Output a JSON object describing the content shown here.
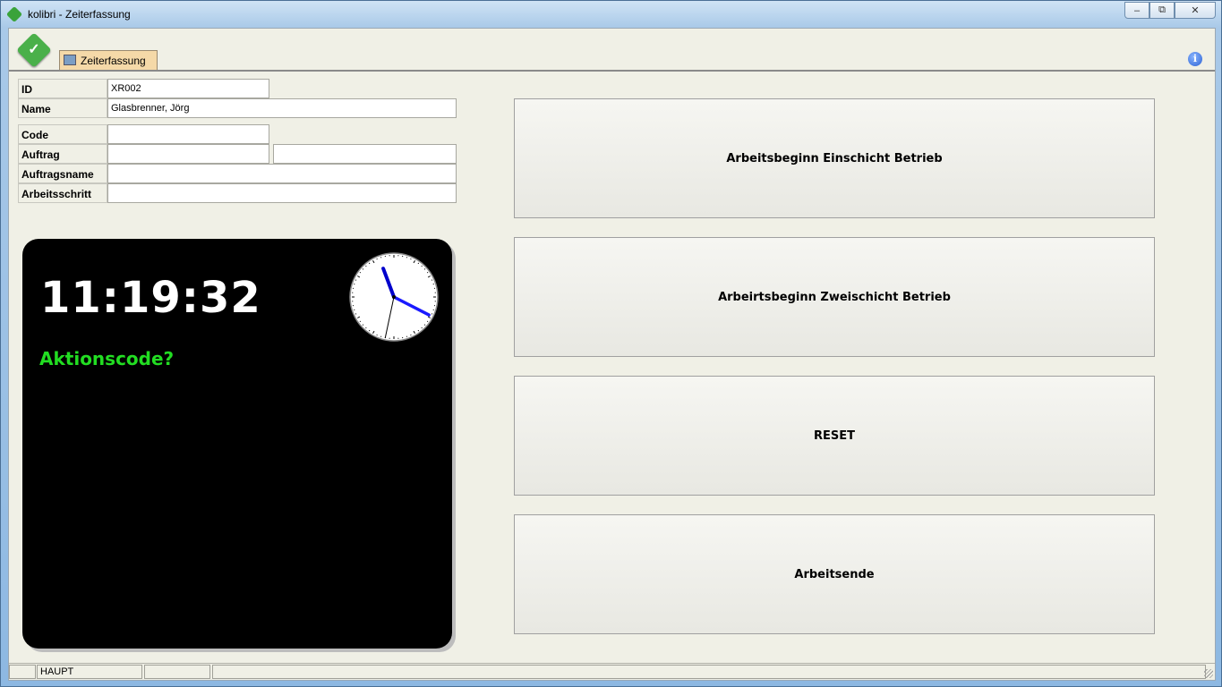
{
  "window": {
    "title": "kolibri - Zeiterfassung"
  },
  "toolbar": {
    "tab_label": "Zeiterfassung",
    "info_glyph": "i"
  },
  "form": {
    "id": {
      "label": "ID",
      "value": "XR002"
    },
    "name": {
      "label": "Name",
      "value": "Glasbrenner, Jörg"
    },
    "code": {
      "label": "Code",
      "value": ""
    },
    "auftrag": {
      "label": "Auftrag",
      "value": "",
      "value2": ""
    },
    "auftragsname": {
      "label": "Auftragsname",
      "value": ""
    },
    "arbeitsschritt": {
      "label": "Arbeitsschritt",
      "value": ""
    }
  },
  "clock": {
    "time": "11:19:32",
    "prompt": "Aktionscode?",
    "hours": 11,
    "minutes": 19,
    "seconds": 32,
    "prompt_color": "#22dd22",
    "hand_color": "#1a1aff"
  },
  "actions": [
    {
      "label": "Arbeitsbeginn Einschicht Betrieb"
    },
    {
      "label": "Arbeirtsbeginn Zweischicht Betrieb"
    },
    {
      "label": "RESET"
    },
    {
      "label": "Arbeitsende"
    }
  ],
  "status": {
    "panel1": "",
    "panel2": "HAUPT",
    "panel3": "",
    "panel4": ""
  }
}
